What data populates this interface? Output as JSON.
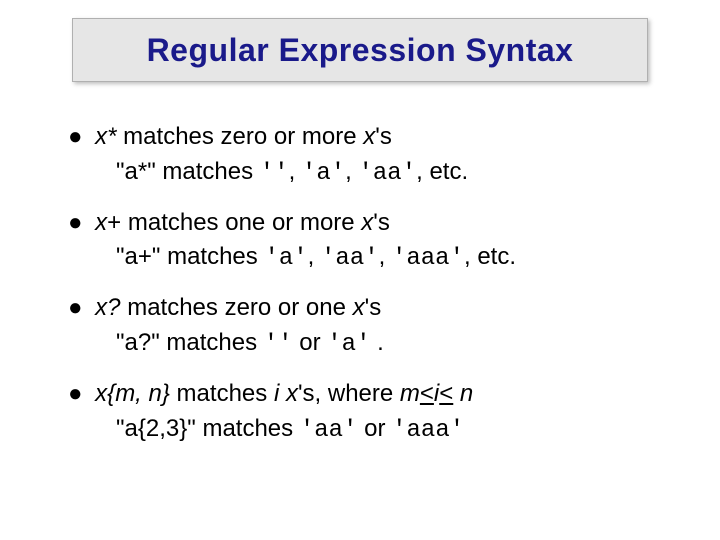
{
  "title": "Regular Expression Syntax",
  "bullets": [
    {
      "sym_pre": "x",
      "sym_op": "*",
      "matches_text": " matches zero or more ",
      "sym_post": "x",
      "tail": "'s",
      "ex_lead": "\"a*\" matches ",
      "ex_codes": [
        "''",
        "'a'",
        "'aa'"
      ],
      "ex_seps": [
        ", ",
        ", ",
        ",  "
      ],
      "ex_tail": "etc."
    },
    {
      "sym_pre": "x",
      "sym_op": "+",
      "matches_text": " matches one or more ",
      "sym_post": "x",
      "tail": "'s",
      "ex_lead": "\"a+\" matches ",
      "ex_codes": [
        "'a'",
        "'aa'",
        "'aaa'"
      ],
      "ex_seps": [
        ", ",
        ", ",
        ", "
      ],
      "ex_tail": "etc."
    },
    {
      "sym_pre": "x",
      "sym_op": "?",
      "matches_text": " matches zero or one ",
      "sym_post": "x",
      "tail": "'s",
      "ex_lead": "\"a?\" matches ",
      "ex_codes": [
        "''",
        "'a'"
      ],
      "ex_seps": [
        " or ",
        " "
      ],
      "ex_tail": "."
    },
    {
      "sym_pre": "x",
      "sym_op": "{m, n}",
      "matches_text": " matches ",
      "mid_it": "i ",
      "mid_it2": "x",
      "mid_plain": "'s, where ",
      "range_m": "m",
      "range_le1": "<",
      "range_i": "i",
      "range_le2": "<",
      "range_n": " n",
      "ex_lead": "\"a{2,3}\" matches ",
      "ex_codes": [
        "'aa'",
        "'aaa'"
      ],
      "ex_seps": [
        "  or  ",
        ""
      ],
      "ex_tail": ""
    }
  ]
}
